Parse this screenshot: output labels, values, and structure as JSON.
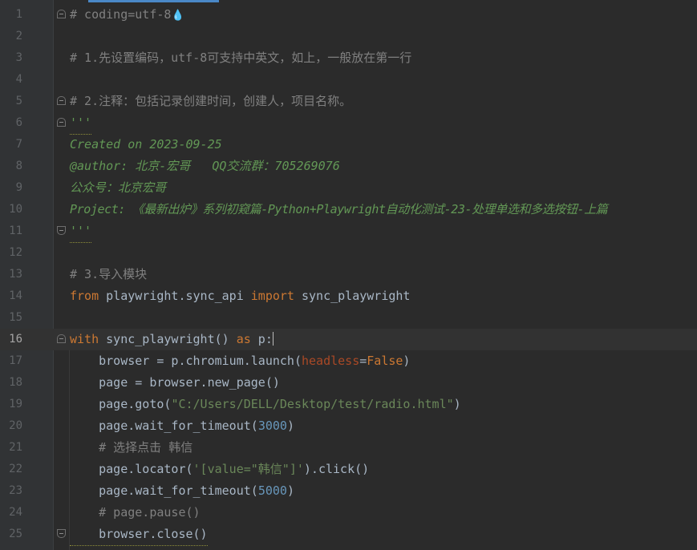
{
  "editor": {
    "current_line": 16,
    "lines": [
      {
        "n": "1",
        "text": "# coding=utf-8"
      },
      {
        "n": "2",
        "text": ""
      },
      {
        "n": "3",
        "text": "# 1.先设置编码，utf-8可支持中英文，如上，一般放在第一行"
      },
      {
        "n": "4",
        "text": ""
      },
      {
        "n": "5",
        "text": "# 2.注释：包括记录创建时间，创建人，项目名称。"
      },
      {
        "n": "6",
        "text": "'''"
      },
      {
        "n": "7",
        "text": "Created on 2023-09-25"
      },
      {
        "n": "8",
        "text": "@author: 北京-宏哥   QQ交流群：705269076"
      },
      {
        "n": "9",
        "text": "公众号：北京宏哥"
      },
      {
        "n": "10",
        "text": "Project: 《最新出炉》系列初窥篇-Python+Playwright自动化测试-23-处理单选和多选按钮-上篇"
      },
      {
        "n": "11",
        "text": "'''"
      },
      {
        "n": "12",
        "text": ""
      },
      {
        "n": "13",
        "text": "# 3.导入模块"
      },
      {
        "n": "14",
        "kw1": "from",
        "mid": " playwright.sync_api ",
        "kw2": "import",
        "tail": " sync_playwright"
      },
      {
        "n": "15",
        "text": ""
      },
      {
        "n": "16",
        "kw1": "with",
        "mid": " sync_playwright() ",
        "kw2": "as",
        "tail": " p:"
      },
      {
        "n": "17",
        "pre": "    browser = p.chromium.launch(",
        "param": "headless",
        "eq": "=",
        "val": "False",
        "post": ")"
      },
      {
        "n": "18",
        "text": "    page = browser.new_page()"
      },
      {
        "n": "19",
        "pre": "    page.goto(",
        "str": "\"C:/Users/DELL/Desktop/test/radio.html\"",
        "post": ")"
      },
      {
        "n": "20",
        "pre": "    page.wait_for_timeout(",
        "num": "3000",
        "post": ")"
      },
      {
        "n": "21",
        "text": "    # 选择点击 韩信"
      },
      {
        "n": "22",
        "pre": "    page.locator(",
        "str": "'[value=\"韩信\"]'",
        "post": ").click()"
      },
      {
        "n": "23",
        "pre": "    page.wait_for_timeout(",
        "num": "5000",
        "post": ")"
      },
      {
        "n": "24",
        "text": "    # page.pause()"
      },
      {
        "n": "25",
        "text": "    browser.close()"
      }
    ]
  },
  "icons": {
    "flame": "flame-icon"
  }
}
